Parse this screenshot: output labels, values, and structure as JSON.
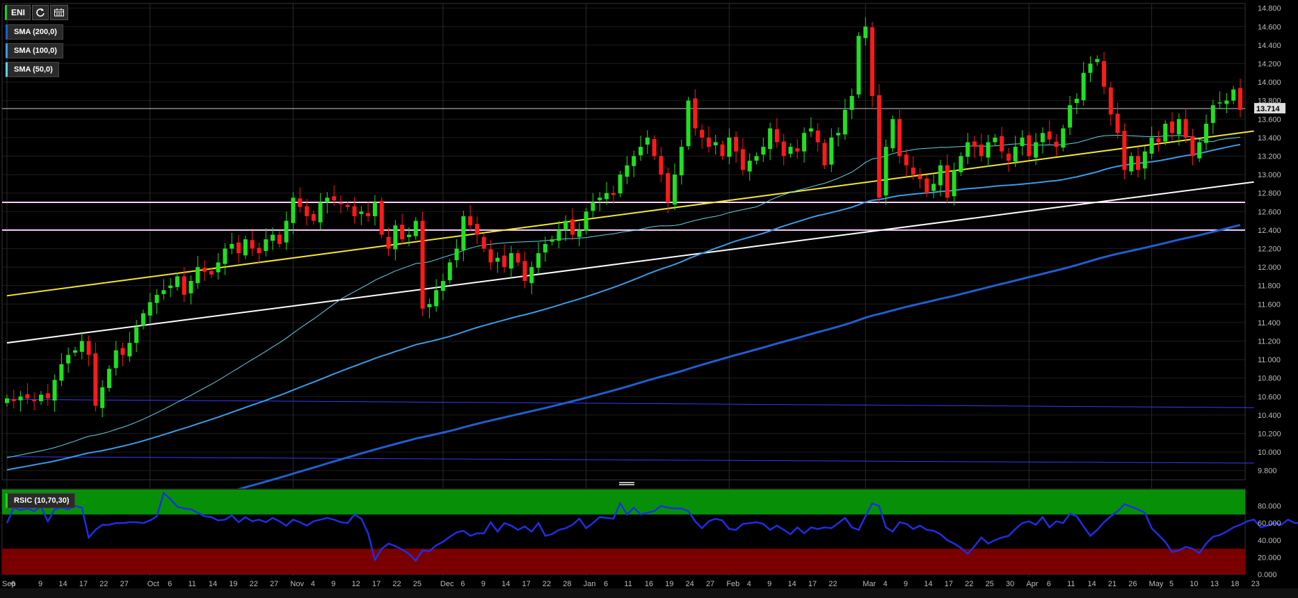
{
  "toolbar": {
    "symbol": "ENI",
    "refresh_icon": "refresh-icon",
    "calendar_icon": "calendar-icon"
  },
  "indicators": [
    {
      "label": "SMA (200,0)",
      "color": "#1f5fcf"
    },
    {
      "label": "SMA (100,0)",
      "color": "#3a9be8"
    },
    {
      "label": "SMA (50,0)",
      "color": "#5fd7e6"
    }
  ],
  "rsi": {
    "label": "RSIC (10,70,30)",
    "color": "#1e2ee6",
    "overbought": 70,
    "oversold": 30
  },
  "price_tag": "13.714",
  "colors": {
    "up": "#20e020",
    "down": "#ff1a1a",
    "yellow_trend": "#f5e632",
    "white_trend": "#ffffff",
    "support": "#ffd0ff",
    "overbought_zone": "#079007",
    "oversold_zone": "#7a0000"
  },
  "chart_data": {
    "type": "candlestick",
    "y_axis": {
      "range": [
        9.7,
        14.85
      ],
      "ticks": [
        "9.800",
        "10.000",
        "10.200",
        "10.400",
        "10.600",
        "10.800",
        "11.000",
        "11.200",
        "11.400",
        "11.600",
        "11.800",
        "12.000",
        "12.200",
        "12.400",
        "12.600",
        "12.800",
        "13.000",
        "13.200",
        "13.400",
        "13.600",
        "13.800",
        "14.000",
        "14.200",
        "14.400",
        "14.600",
        "14.800"
      ]
    },
    "x_labels": [
      {
        "i": 0,
        "t": "Sep"
      },
      {
        "i": 1,
        "t": "6"
      },
      {
        "i": 5,
        "t": "9"
      },
      {
        "i": 8,
        "t": "14"
      },
      {
        "i": 11,
        "t": "17"
      },
      {
        "i": 14,
        "t": "22"
      },
      {
        "i": 17,
        "t": "27"
      },
      {
        "i": 21,
        "t": "Oct"
      },
      {
        "i": 24,
        "t": "6"
      },
      {
        "i": 27,
        "t": "11"
      },
      {
        "i": 30,
        "t": "14"
      },
      {
        "i": 33,
        "t": "19"
      },
      {
        "i": 36,
        "t": "22"
      },
      {
        "i": 39,
        "t": "27"
      },
      {
        "i": 42,
        "t": "Nov"
      },
      {
        "i": 45,
        "t": "4"
      },
      {
        "i": 48,
        "t": "9"
      },
      {
        "i": 51,
        "t": "12"
      },
      {
        "i": 54,
        "t": "17"
      },
      {
        "i": 57,
        "t": "22"
      },
      {
        "i": 60,
        "t": "25"
      },
      {
        "i": 64,
        "t": "Dec"
      },
      {
        "i": 67,
        "t": "6"
      },
      {
        "i": 70,
        "t": "9"
      },
      {
        "i": 73,
        "t": "14"
      },
      {
        "i": 76,
        "t": "17"
      },
      {
        "i": 79,
        "t": "22"
      },
      {
        "i": 82,
        "t": "28"
      },
      {
        "i": 85,
        "t": "Jan"
      },
      {
        "i": 88,
        "t": "6"
      },
      {
        "i": 91,
        "t": "11"
      },
      {
        "i": 94,
        "t": "16"
      },
      {
        "i": 97,
        "t": "19"
      },
      {
        "i": 100,
        "t": "24"
      },
      {
        "i": 103,
        "t": "27"
      },
      {
        "i": 106,
        "t": "Feb"
      },
      {
        "i": 109,
        "t": "4"
      },
      {
        "i": 112,
        "t": "9"
      },
      {
        "i": 115,
        "t": "14"
      },
      {
        "i": 118,
        "t": "17"
      },
      {
        "i": 121,
        "t": "22"
      },
      {
        "i": 126,
        "t": "Mar"
      },
      {
        "i": 129,
        "t": "4"
      },
      {
        "i": 132,
        "t": "9"
      },
      {
        "i": 135,
        "t": "14"
      },
      {
        "i": 138,
        "t": "17"
      },
      {
        "i": 141,
        "t": "22"
      },
      {
        "i": 144,
        "t": "25"
      },
      {
        "i": 147,
        "t": "30"
      },
      {
        "i": 150,
        "t": "Apr"
      },
      {
        "i": 153,
        "t": "6"
      },
      {
        "i": 156,
        "t": "11"
      },
      {
        "i": 159,
        "t": "14"
      },
      {
        "i": 162,
        "t": "21"
      },
      {
        "i": 165,
        "t": "26"
      },
      {
        "i": 168,
        "t": "May"
      },
      {
        "i": 171,
        "t": "5"
      },
      {
        "i": 174,
        "t": "10"
      },
      {
        "i": 177,
        "t": "13"
      },
      {
        "i": 180,
        "t": "18"
      },
      {
        "i": 183,
        "t": "23"
      }
    ],
    "horizontal_lines": [
      {
        "value": 13.714,
        "color": "#cccccc"
      },
      {
        "value": 12.7,
        "color": "#ffd0ff"
      },
      {
        "value": 12.4,
        "color": "#ffd0ff"
      }
    ],
    "trend_lines": [
      {
        "from": [
          0,
          11.69
        ],
        "to": [
          183,
          13.47
        ],
        "color": "#f5e632"
      },
      {
        "from": [
          0,
          11.18
        ],
        "to": [
          183,
          12.92
        ],
        "color": "#ffffff"
      },
      {
        "from": [
          0,
          10.57
        ],
        "to": [
          183,
          10.48
        ],
        "color": "#3a3aff"
      },
      {
        "from": [
          0,
          9.95
        ],
        "to": [
          183,
          9.88
        ],
        "color": "#3a3aff"
      }
    ],
    "close": [
      10.58,
      10.55,
      10.6,
      10.58,
      10.55,
      10.62,
      10.58,
      10.78,
      10.95,
      11.05,
      11.1,
      11.2,
      11.05,
      10.5,
      10.7,
      10.9,
      11.1,
      11.05,
      11.18,
      11.35,
      11.5,
      11.62,
      11.7,
      11.75,
      11.8,
      11.9,
      11.7,
      11.85,
      12,
      11.95,
      11.92,
      12.05,
      12.2,
      12.25,
      12.15,
      12.3,
      12.2,
      12.15,
      12.3,
      12.35,
      12.25,
      12.5,
      12.75,
      12.65,
      12.55,
      12.5,
      12.7,
      12.75,
      12.72,
      12.68,
      12.65,
      12.55,
      12.6,
      12.55,
      12.7,
      12.35,
      12.2,
      12.45,
      12.3,
      12.35,
      12.5,
      11.55,
      11.6,
      11.75,
      11.85,
      12.05,
      12.2,
      12.55,
      12.45,
      12.35,
      12.2,
      12.05,
      12.1,
      12.0,
      12.15,
      12.05,
      11.85,
      12.0,
      12.15,
      12.25,
      12.3,
      12.4,
      12.5,
      12.35,
      12.4,
      12.6,
      12.7,
      12.75,
      12.8,
      12.78,
      13.0,
      13.1,
      13.2,
      13.3,
      13.4,
      13.2,
      13.0,
      12.7,
      13.0,
      13.3,
      13.8,
      13.5,
      13.4,
      13.3,
      13.35,
      13.2,
      13.4,
      13.25,
      13.05,
      13.15,
      13.2,
      13.3,
      13.5,
      13.35,
      13.2,
      13.3,
      13.25,
      13.45,
      13.5,
      13.35,
      13.1,
      13.4,
      13.45,
      13.7,
      13.85,
      14.5,
      14.6,
      13.85,
      12.75,
      13.3,
      13.6,
      13.2,
      13.1,
      13.0,
      12.95,
      12.8,
      12.9,
      13.1,
      12.75,
      13.05,
      13.2,
      13.35,
      13.3,
      13.2,
      13.35,
      13.4,
      13.25,
      13.15,
      13.3,
      13.4,
      13.2,
      13.35,
      13.45,
      13.38,
      13.3,
      13.5,
      13.75,
      13.82,
      14.1,
      14.2,
      14.25,
      13.95,
      13.65,
      13.45,
      13.05,
      13.2,
      13.05,
      13.25,
      13.4,
      13.35,
      13.55,
      13.45,
      13.6,
      13.4,
      13.2,
      13.35,
      13.55,
      13.75,
      13.78,
      13.8,
      13.92,
      13.7
    ],
    "rsi_values": [
      60,
      78,
      75,
      77,
      74,
      79,
      62,
      76,
      78,
      76,
      80,
      78,
      43,
      52,
      58,
      58,
      60,
      60,
      61,
      61,
      60,
      63,
      68,
      95,
      88,
      79,
      77,
      76,
      72,
      68,
      67,
      63,
      64,
      69,
      61,
      67,
      62,
      64,
      61,
      66,
      62,
      57,
      64,
      61,
      57,
      62,
      64,
      66,
      64,
      61,
      60,
      70,
      65,
      48,
      17,
      30,
      36,
      33,
      29,
      24,
      16,
      28,
      27,
      34,
      38,
      44,
      49,
      51,
      45,
      48,
      48,
      61,
      50,
      60,
      57,
      52,
      56,
      50,
      60,
      45,
      47,
      52,
      54,
      58,
      65,
      54,
      60,
      67,
      66,
      65,
      83,
      70,
      78,
      70,
      72,
      74,
      80,
      78,
      77,
      77,
      74,
      62,
      54,
      62,
      65,
      63,
      53,
      52,
      59,
      60,
      61,
      59,
      52,
      57,
      52,
      47,
      55,
      48,
      55,
      53,
      55,
      54,
      60,
      66,
      55,
      52,
      68,
      83,
      80,
      55,
      50,
      61,
      59,
      53,
      57,
      52,
      51,
      47,
      40,
      36,
      31,
      24,
      33,
      43,
      36,
      40,
      43,
      45,
      53,
      60,
      62,
      58,
      67,
      55,
      62,
      60,
      71,
      68,
      56,
      45,
      52,
      61,
      68,
      74,
      82,
      79,
      76,
      72,
      54,
      46,
      38,
      26,
      28,
      32,
      30,
      25,
      36,
      44,
      46,
      50,
      55,
      58,
      62,
      64,
      55,
      57,
      60,
      58,
      64,
      60,
      60,
      60,
      67
    ]
  }
}
